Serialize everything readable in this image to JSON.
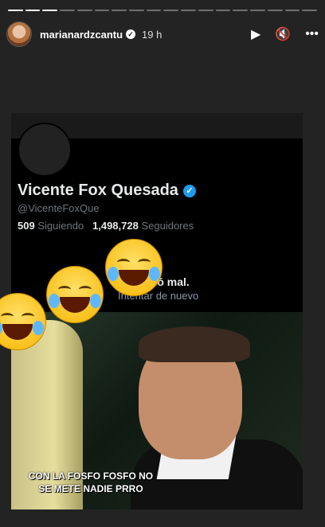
{
  "story": {
    "username": "marianardzcantu",
    "time": "19 h",
    "progress_segments": [
      true,
      true,
      true,
      false,
      false,
      false,
      false,
      false,
      false,
      false,
      false,
      false,
      false,
      false,
      false,
      false,
      false,
      false
    ]
  },
  "twitter_profile": {
    "name": "Vicente Fox Quesada",
    "handle": "@VicenteFoxQue",
    "following_count": "509",
    "following_label": "Siguiendo",
    "followers_count": "1,498,728",
    "followers_label": "Seguidores",
    "error_text": "salió mal.",
    "retry_text": "Intentar de nuevo"
  },
  "meme": {
    "caption_line1": "CON LA FOSFO FOSFO NO",
    "caption_line2": "SE METE NADIE PRRO"
  }
}
